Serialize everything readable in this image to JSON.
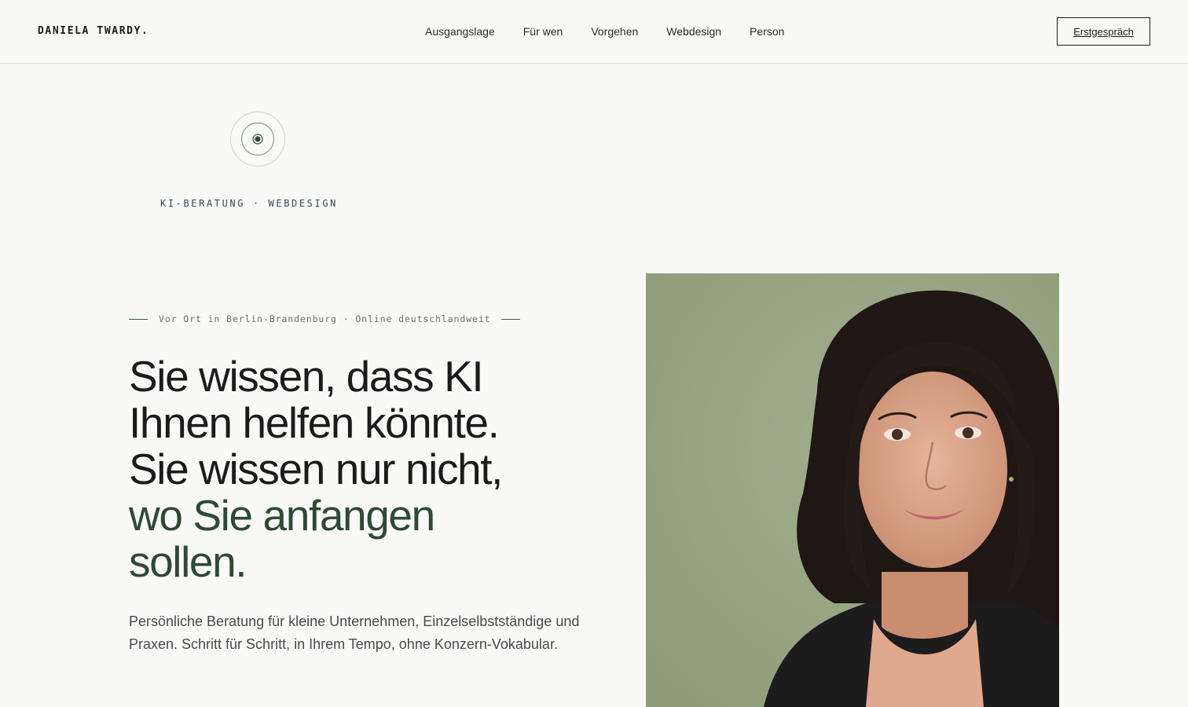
{
  "header": {
    "logo": "DANIELA TWARDY.",
    "nav": [
      {
        "label": "Ausgangslage"
      },
      {
        "label": "Für wen"
      },
      {
        "label": "Vorgehen"
      },
      {
        "label": "Webdesign"
      },
      {
        "label": "Person"
      }
    ],
    "cta_label": "Erstgespräch"
  },
  "badge": {
    "icon": "target-icon",
    "eyebrow": "KI-BERATUNG · WEBDESIGN"
  },
  "hero": {
    "location": "Vor Ort in Berlin-Brandenburg · Online deutschlandweit",
    "headline_lines": [
      "Sie wissen, dass KI",
      "Ihnen helfen könnte.",
      "Sie wissen nur nicht,"
    ],
    "headline_accent_lines": [
      "wo Sie anfangen",
      "sollen."
    ],
    "lead": "Persönliche Beratung für kleine Unternehmen, Einzelselbstständige und Praxen. Schritt für Schritt, in Ihrem Tempo, ohne Konzern-Vokabular."
  },
  "colors": {
    "accent_green": "#2c4a36",
    "eyebrow_blue": "#2e4a52",
    "portrait_background": "#98a684",
    "page_background": "#f9f9f8"
  }
}
